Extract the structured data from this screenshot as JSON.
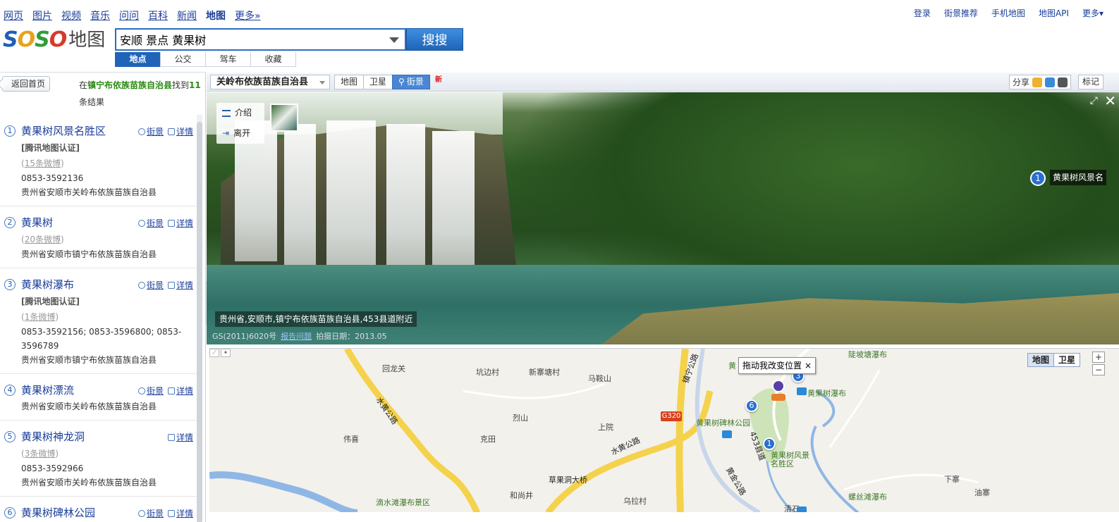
{
  "topnav": {
    "channels": [
      "网页",
      "图片",
      "视频",
      "音乐",
      "问问",
      "百科",
      "新闻",
      "地图",
      "更多»"
    ],
    "links": [
      "登录",
      "街景推荐",
      "手机地图",
      "地图API",
      "更多▾"
    ]
  },
  "logo": {
    "brand": "SOSO",
    "suffix": "地图"
  },
  "search": {
    "query": "安顺 景点 黄果树",
    "button": "搜搜",
    "modes": [
      "地点",
      "公交",
      "驾车",
      "收藏"
    ]
  },
  "leftpanel": {
    "back": "返回首页",
    "info_prefix": "在",
    "info_region": "镇宁布依族苗族自治县",
    "info_mid": "找到",
    "info_count": "11",
    "info_suffix": "条结果",
    "results": [
      {
        "num": "1",
        "name": "黄果树风景名胜区",
        "street": "街景",
        "detail": "详情",
        "cert": "[腾讯地图认证]",
        "weibo": "15条微博",
        "phone": "0853-3592136",
        "addr": "贵州省安顺市关岭布依族苗族自治县"
      },
      {
        "num": "2",
        "name": "黄果树",
        "street": "街景",
        "detail": "详情",
        "weibo": "20条微博",
        "addr": "贵州省安顺市镇宁布依族苗族自治县"
      },
      {
        "num": "3",
        "name": "黄果树瀑布",
        "street": "街景",
        "detail": "详情",
        "cert": "[腾讯地图认证]",
        "weibo": "1条微博",
        "phone": "0853-3592156; 0853-3596800; 0853-3596789",
        "addr": "贵州省安顺市镇宁布依族苗族自治县"
      },
      {
        "num": "4",
        "name": "黄果树漂流",
        "street": "街景",
        "detail": "详情",
        "addr": "贵州省安顺市关岭布依族苗族自治县"
      },
      {
        "num": "5",
        "name": "黄果树神龙洞",
        "detail": "详情",
        "weibo": "3条微博",
        "phone": "0853-3592966",
        "addr": "贵州省安顺市关岭布依族苗族自治县"
      },
      {
        "num": "6",
        "name": "黄果树碑林公园",
        "street": "街景",
        "detail": "详情"
      }
    ]
  },
  "svtoolbar": {
    "region": "关岭布依族苗族自治县",
    "tabs": [
      "地图",
      "卫星",
      "街景"
    ],
    "new_badge": "新",
    "share": "分享",
    "mark": "标记"
  },
  "streetview": {
    "panel": [
      "介绍",
      "离开"
    ],
    "marker_num": "1",
    "marker_label": "黄果树风景名",
    "address": "贵州省,安顺市,镇宁布依族苗族自治县,453县道附近",
    "copyright": "GS(2011)6020号",
    "report": "报告问题",
    "shot_date": "拍摄日期：2013.05"
  },
  "map": {
    "drag_tip": "拖动我改变位置",
    "close": "×",
    "types": [
      "地图",
      "卫星"
    ],
    "zoom_in": "+",
    "zoom_out": "−",
    "highway": "G320",
    "labels": {
      "huilongguan": "回龙关",
      "kengbian": "坑边村",
      "xinzhai": "新寨塘村",
      "maan": "马鞍山",
      "lieshan": "烈山",
      "shangyuan": "上院",
      "weixi": "伟喜",
      "ketian": "克田",
      "caoguodong": "草果洞大桥",
      "heshangjing": "和尚井",
      "wulacun": "乌拉村",
      "dishuitan": "滴水滩瀑布景区",
      "beilin": "黄果树碑林公园",
      "pubu": "黄果树瀑布",
      "fengjing": "黄果树风景名胜区",
      "luosi": "螺丝滩瀑布",
      "xiazhai": "下寨",
      "youzhai": "油寨",
      "doupotang": "陡坡塘瀑布",
      "huang": "黄",
      "road_shuihuang": "水黄公路",
      "road_shuihuang2": "水黄公路",
      "road_453": "453县道",
      "road_huangjin": "黄金公路",
      "road_qingshui": "清石",
      "road_zhenning": "镇宁公路"
    },
    "pins": [
      "1",
      "6",
      "3"
    ]
  }
}
